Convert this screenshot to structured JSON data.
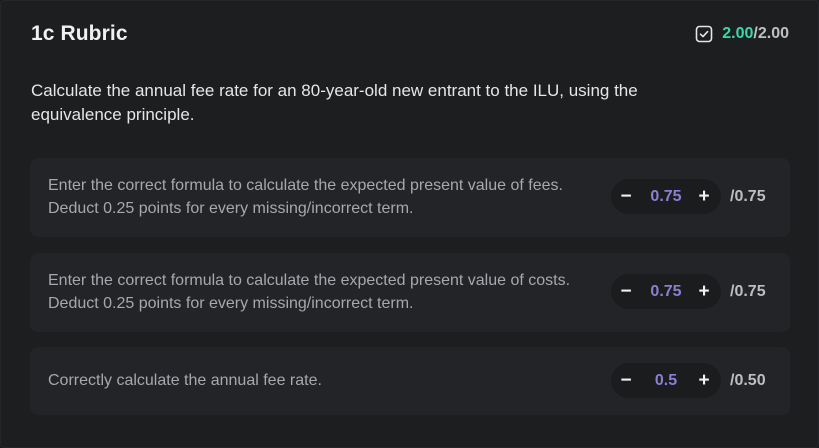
{
  "rubric": {
    "title": "1c Rubric",
    "score_earned": "2.00",
    "score_max": "/2.00",
    "prompt": "Calculate the annual fee rate for an 80-year-old new entrant to the ILU, using the equivalence principle.",
    "criteria": [
      {
        "text": "Enter the correct formula to calculate the expected present value of fees. Deduct 0.25 points for every missing/incorrect term.",
        "value": "0.75",
        "max": "/0.75"
      },
      {
        "text": "Enter the correct formula to calculate the expected present value of costs. Deduct 0.25 points for every missing/incorrect term.",
        "value": "0.75",
        "max": "/0.75"
      },
      {
        "text": "Correctly calculate the annual fee rate.",
        "value": "0.5",
        "max": "/0.50"
      }
    ]
  },
  "controls": {
    "minus": "−",
    "plus": "+"
  },
  "icons": {
    "score_icon": "checkbox-checked-icon"
  },
  "colors": {
    "earned": "#3ed6a9",
    "value": "#8a7fd3"
  }
}
